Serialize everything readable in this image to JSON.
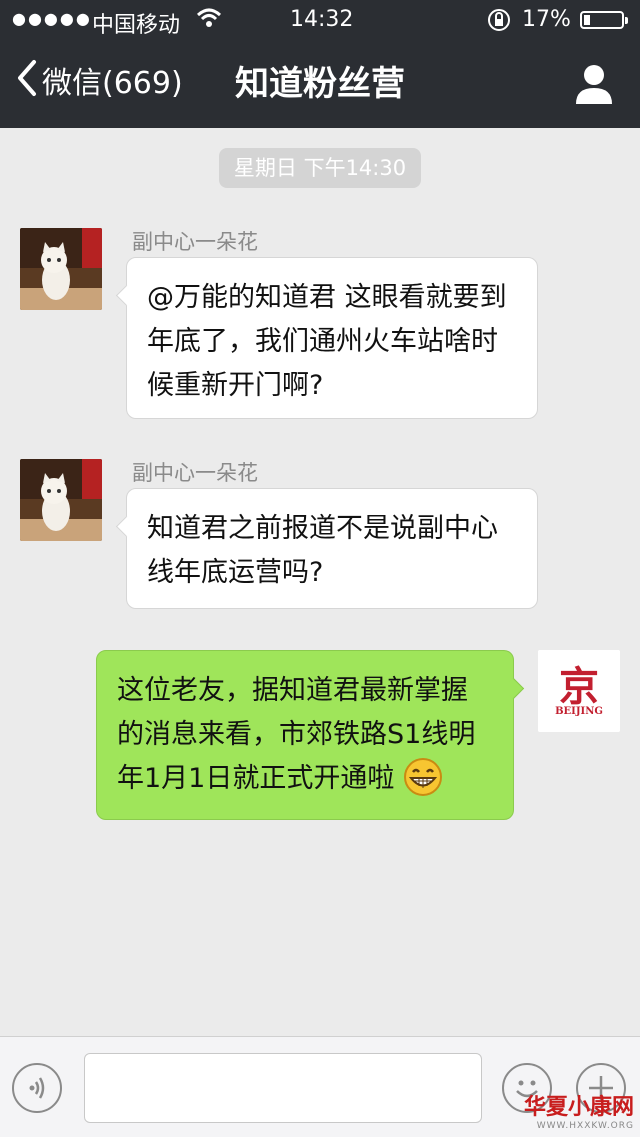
{
  "status_bar": {
    "signal": "●●●●●",
    "carrier": "中国移动",
    "time": "14:32",
    "battery_percent": "17%",
    "battery_level": 0.17
  },
  "nav": {
    "back_label": "微信(669)",
    "title": "知道粉丝营",
    "back_icon": "chevron-left-icon",
    "profile_icon": "person-icon"
  },
  "timestamp": "星期日 下午14:30",
  "messages": [
    {
      "sender": "副中心一朵花",
      "text": "@万能的知道君 这眼看就要到年底了，我们通州火车站啥时候重新开门啊?"
    },
    {
      "sender": "副中心一朵花",
      "text": "知道君之前报道不是说副中心线年底运营吗?"
    },
    {
      "text": "这位老友，据知道君最新掌握的消息来看，市郊铁路S1线明年1月1日就正式开通啦",
      "emoji": "grin-emoji",
      "avatar_text": "京",
      "avatar_subtext": "BEIJING"
    }
  ],
  "watermark": {
    "name": "华夏小康网",
    "url": "WWW.HXXKW.ORG"
  },
  "colors": {
    "nav_bg": "#2b2e33",
    "chat_bg": "#ebebeb",
    "incoming_bubble": "#ffffff",
    "outgoing_bubble": "#9fe55a",
    "beijing_red": "#c21f2f"
  }
}
